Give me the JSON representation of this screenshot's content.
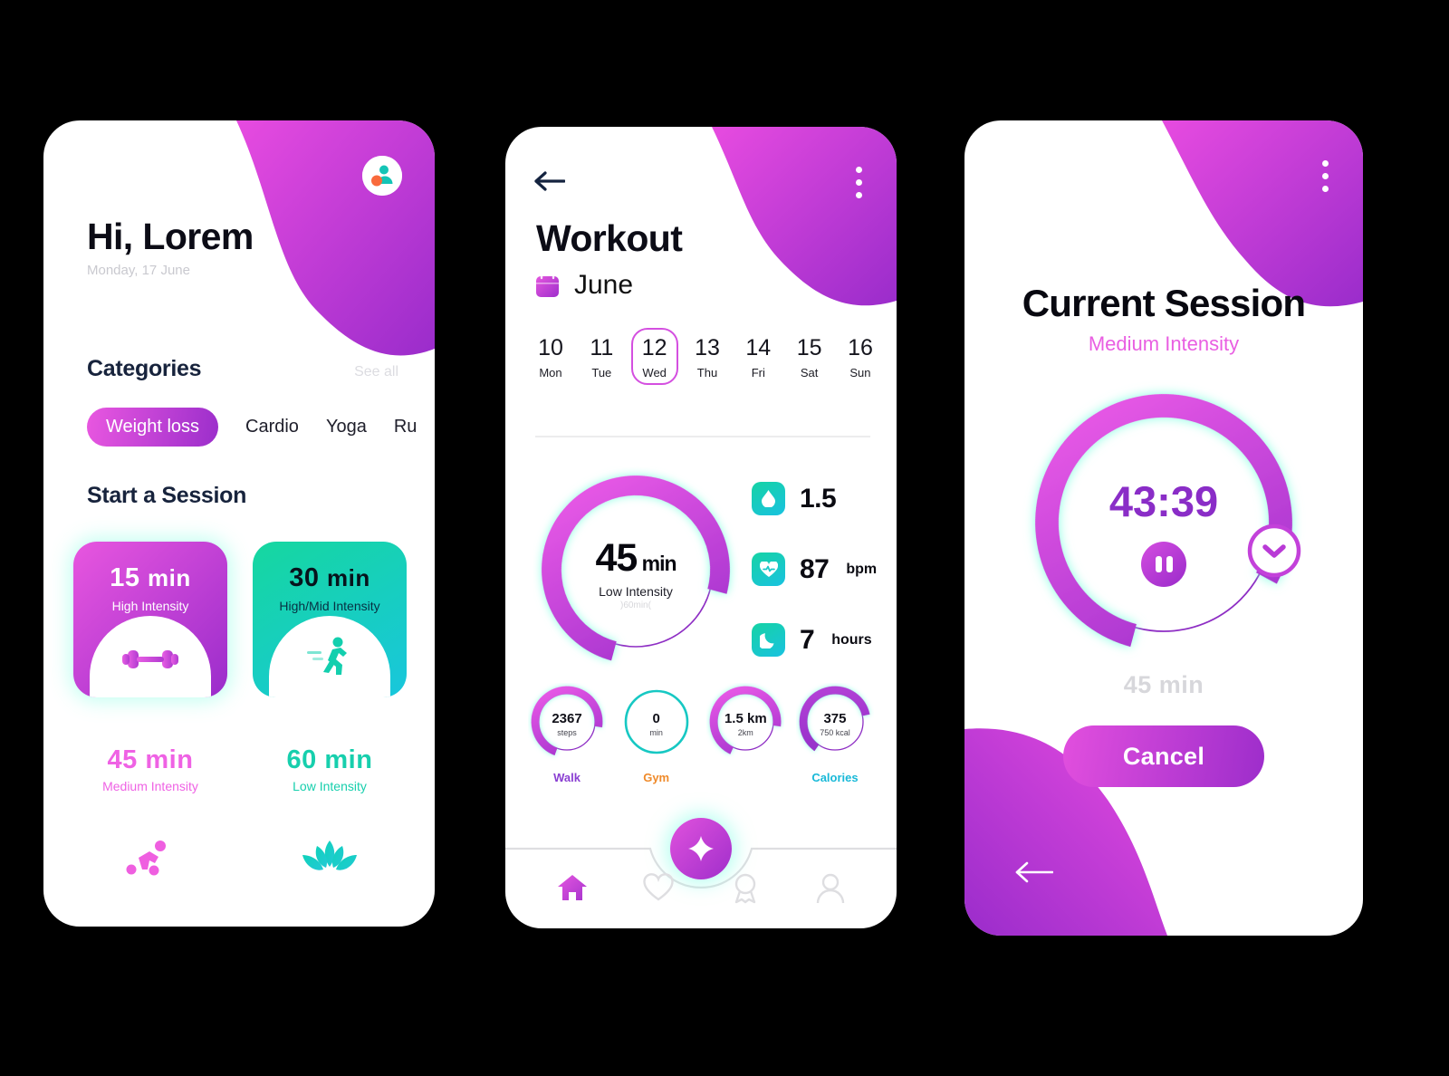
{
  "theme": {
    "magenta": "#e856df",
    "purple": "#9a2ccb",
    "teal": "#16d79f",
    "cyan": "#19c2e0",
    "dark": "#0c0c16",
    "muted": "#c9c9cf",
    "orange": "#ef8a2a",
    "background": "#000000"
  },
  "screen1": {
    "greeting": "Hi, Lorem",
    "date": "Monday, 17 June",
    "avatar_icon": "user-avatar-icon",
    "categories": {
      "title": "Categories",
      "see_all": "See all",
      "chips": [
        {
          "label": "Weight loss",
          "active": true
        },
        {
          "label": "Cardio",
          "active": false
        },
        {
          "label": "Yoga",
          "active": false
        },
        {
          "label": "Ru",
          "active": false
        }
      ]
    },
    "start_session": {
      "title": "Start a Session",
      "tiles": [
        {
          "duration": "15",
          "unit": "min",
          "intensity": "High Intensity",
          "style": "pink",
          "icon": "dumbbell-icon"
        },
        {
          "duration": "30",
          "unit": "min",
          "intensity": "High/Mid Intensity",
          "style": "teal",
          "icon": "running-icon"
        }
      ],
      "options": [
        {
          "duration": "45",
          "unit": "min",
          "intensity": "Medium Intensity",
          "style": "pink",
          "icon": "skating-icon"
        },
        {
          "duration": "60",
          "unit": "min",
          "intensity": "Low Intensity",
          "style": "teal",
          "icon": "lotus-icon"
        }
      ]
    }
  },
  "screen2": {
    "back_icon": "back-arrow-icon",
    "menu_icon": "kebab-menu-icon",
    "title": "Workout",
    "calendar_icon": "calendar-icon",
    "month": "June",
    "days": [
      {
        "num": "10",
        "weekday": "Mon",
        "selected": false
      },
      {
        "num": "11",
        "weekday": "Tue",
        "selected": false
      },
      {
        "num": "12",
        "weekday": "Wed",
        "selected": true
      },
      {
        "num": "13",
        "weekday": "Thu",
        "selected": false
      },
      {
        "num": "14",
        "weekday": "Fri",
        "selected": false
      },
      {
        "num": "15",
        "weekday": "Sat",
        "selected": false
      },
      {
        "num": "16",
        "weekday": "Sun",
        "selected": false
      }
    ],
    "main_ring": {
      "value": "45",
      "unit": "min",
      "label": "Low Intensity",
      "goal": "60min",
      "percent": 75
    },
    "stats": [
      {
        "icon": "water-drop-icon",
        "value": "1.5",
        "unit": ""
      },
      {
        "icon": "heart-pulse-icon",
        "value": "87",
        "unit": "bpm"
      },
      {
        "icon": "moon-icon",
        "value": "7",
        "unit": "hours"
      }
    ],
    "mini_rings": [
      {
        "value": "2367",
        "unit": "steps",
        "label": "Walk",
        "percent": 72,
        "color": "#c24bd8",
        "label_color": "#8a3fd2"
      },
      {
        "value": "0",
        "unit": "min",
        "label": "Gym",
        "percent": 0,
        "color": "#17c8c3",
        "label_color": "#ef8a2a"
      },
      {
        "value": "1.5 km",
        "unit": "2km",
        "label": "",
        "percent": 70,
        "color": "#c24bd8",
        "label_color": "#8a3fd2"
      },
      {
        "value": "375",
        "unit": "750 kcal",
        "label": "Calories",
        "percent": 62,
        "color": "#a83fd2",
        "label_color": "#19b9d8"
      }
    ],
    "fab_icon": "plus-icon",
    "nav": [
      {
        "icon": "home-icon",
        "active": true
      },
      {
        "icon": "heart-icon",
        "active": false
      },
      {
        "icon": "badge-icon",
        "active": false
      },
      {
        "icon": "person-icon",
        "active": false
      }
    ]
  },
  "screen3": {
    "menu_icon": "kebab-menu-icon",
    "title": "Current Session",
    "subtitle": "Medium Intensity",
    "timer": "43:39",
    "pause_icon": "pause-icon",
    "handle_icon": "chevron-down-icon",
    "caption": "45  min",
    "percent": 78,
    "cancel_label": "Cancel",
    "back_icon": "back-arrow-icon"
  }
}
